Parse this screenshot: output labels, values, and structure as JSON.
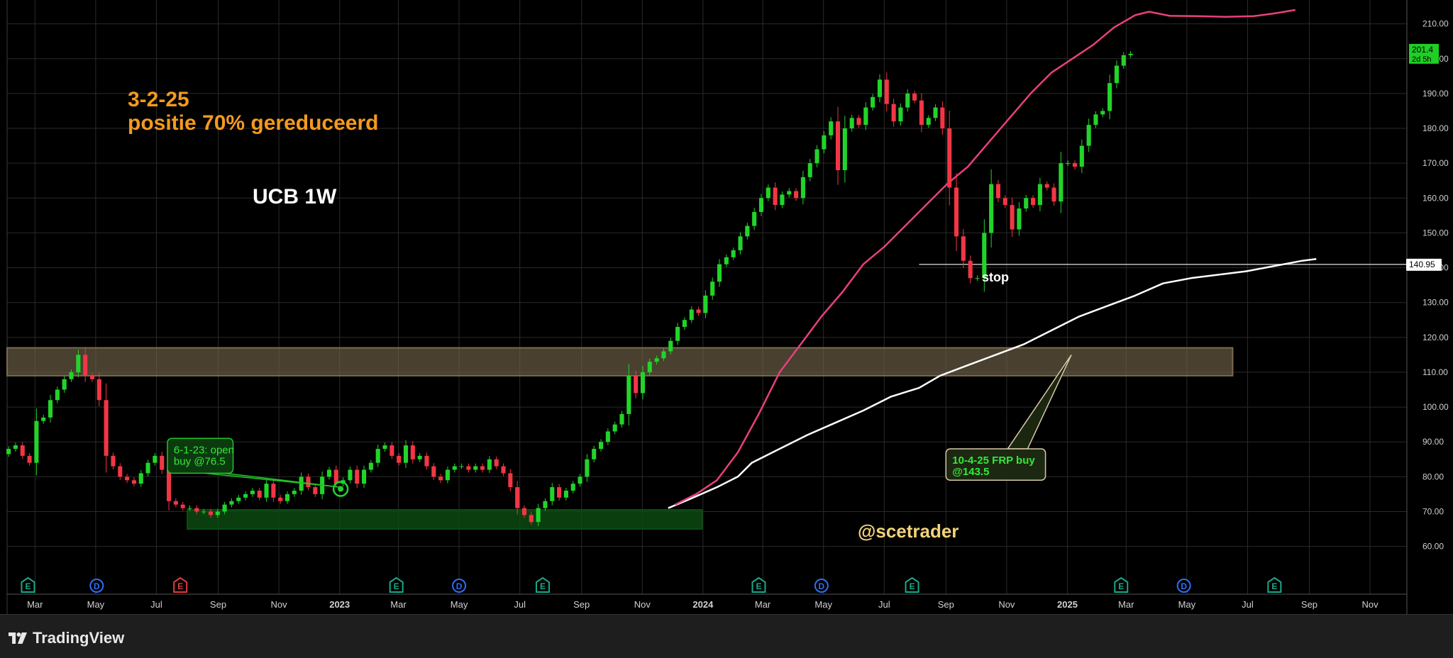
{
  "app": {
    "brand": "TradingView"
  },
  "chart_data": {
    "type": "candlestick",
    "symbol": "UCB",
    "timeframe": "1W",
    "title": "UCB 1W",
    "note_line1": "3-2-25",
    "note_line2": "positie 70% gereduceerd",
    "watermark": "@scetrader",
    "ylim": [
      53,
      214
    ],
    "y_ticks": [
      60,
      70,
      80,
      90,
      100,
      110,
      120,
      130,
      140,
      150,
      160,
      170,
      180,
      190,
      200,
      210
    ],
    "y_tick_labels": [
      "60.00",
      "70.00",
      "80.00",
      "90.00",
      "100.00",
      "110.00",
      "120.00",
      "130.00",
      "140.00",
      "150.00",
      "160.00",
      "170.00",
      "180.00",
      "190.00",
      "200.00",
      "210.00"
    ],
    "xlim": [
      "2022-02-01",
      "2025-12-08"
    ],
    "x_ticks": [
      {
        "date": "2022-03-01",
        "label": "Mar",
        "bold": false
      },
      {
        "date": "2022-05-01",
        "label": "May",
        "bold": false
      },
      {
        "date": "2022-07-01",
        "label": "Jul",
        "bold": false
      },
      {
        "date": "2022-09-01",
        "label": "Sep",
        "bold": false
      },
      {
        "date": "2022-11-01",
        "label": "Nov",
        "bold": false
      },
      {
        "date": "2023-01-01",
        "label": "2023",
        "bold": true
      },
      {
        "date": "2023-03-01",
        "label": "Mar",
        "bold": false
      },
      {
        "date": "2023-05-01",
        "label": "May",
        "bold": false
      },
      {
        "date": "2023-07-01",
        "label": "Jul",
        "bold": false
      },
      {
        "date": "2023-09-01",
        "label": "Sep",
        "bold": false
      },
      {
        "date": "2023-11-01",
        "label": "Nov",
        "bold": false
      },
      {
        "date": "2024-01-01",
        "label": "2024",
        "bold": true
      },
      {
        "date": "2024-03-01",
        "label": "Mar",
        "bold": false
      },
      {
        "date": "2024-05-01",
        "label": "May",
        "bold": false
      },
      {
        "date": "2024-07-01",
        "label": "Jul",
        "bold": false
      },
      {
        "date": "2024-09-01",
        "label": "Sep",
        "bold": false
      },
      {
        "date": "2024-11-01",
        "label": "Nov",
        "bold": false
      },
      {
        "date": "2025-01-01",
        "label": "2025",
        "bold": true
      },
      {
        "date": "2025-03-01",
        "label": "Mar",
        "bold": false
      },
      {
        "date": "2025-05-01",
        "label": "May",
        "bold": false
      },
      {
        "date": "2025-07-01",
        "label": "Jul",
        "bold": false
      },
      {
        "date": "2025-09-01",
        "label": "Sep",
        "bold": false
      },
      {
        "date": "2025-11-01",
        "label": "Nov",
        "bold": false
      }
    ],
    "price_label": {
      "value": "201.4",
      "countdown": "2d 5h",
      "price": 201.4
    },
    "stop_label": {
      "value": "140.95",
      "price": 140.95
    },
    "stop_text": "stop",
    "grid": true,
    "zones": [
      {
        "name": "resistance-zone",
        "from": "2022-02-01",
        "to": "2025-06-16",
        "low": 109,
        "high": 117,
        "fill": "#7a6a4f",
        "opacity": 0.6
      },
      {
        "name": "support-zone",
        "from": "2022-08-01",
        "to": "2023-12-31",
        "low": 65,
        "high": 70.5,
        "fill": "#0c4d12",
        "opacity": 0.8
      }
    ],
    "callouts": [
      {
        "name": "open-buy-callout",
        "line1": "6-1-23: open",
        "line2": "buy @76.5",
        "box_date": "2022-07-12",
        "box_top": 91,
        "box_bottom": 81,
        "box_width_days": 66,
        "pointer_date": "2023-01-02",
        "pointer_price": 77,
        "color": "#22c32a",
        "bg": "#0d3d10"
      },
      {
        "name": "frp-buy-callout",
        "line1": "10-4-25 FRP buy",
        "line2": "@143.5",
        "box_date": "2024-09-01",
        "box_top": 88,
        "box_bottom": 79,
        "box_width_days": 100,
        "pointer_date": "2025-01-05",
        "pointer_price": 115,
        "color": "#d8c8a8",
        "bg": "#1e2a12"
      }
    ],
    "entry_marker": {
      "date": "2023-01-02",
      "price": 76.5
    },
    "events": [
      {
        "type": "E",
        "date": "2022-02-22",
        "color": "#1aa88b"
      },
      {
        "type": "D",
        "date": "2022-05-02",
        "color": "#2f6ef5"
      },
      {
        "type": "E",
        "date": "2022-07-25",
        "color": "#e23b3b"
      },
      {
        "type": "E",
        "date": "2023-02-27",
        "color": "#1aa88b"
      },
      {
        "type": "D",
        "date": "2023-05-01",
        "color": "#2f6ef5"
      },
      {
        "type": "E",
        "date": "2023-07-24",
        "color": "#1aa88b"
      },
      {
        "type": "E",
        "date": "2024-02-26",
        "color": "#1aa88b"
      },
      {
        "type": "D",
        "date": "2024-04-29",
        "color": "#2f6ef5"
      },
      {
        "type": "E",
        "date": "2024-07-29",
        "color": "#1aa88b"
      },
      {
        "type": "E",
        "date": "2025-02-24",
        "color": "#1aa88b"
      },
      {
        "type": "D",
        "date": "2025-04-28",
        "color": "#2f6ef5"
      },
      {
        "type": "E",
        "date": "2025-07-28",
        "color": "#1aa88b"
      }
    ],
    "candle_start": "2022-01-31",
    "candle_interval_days": 7,
    "candle_closes": [
      88,
      89,
      86,
      84,
      96,
      97,
      102,
      105,
      108,
      110,
      115,
      109,
      108,
      102,
      86,
      83,
      80,
      79,
      78,
      81,
      84,
      86,
      82,
      73,
      72,
      71,
      71,
      70,
      70,
      69,
      70,
      72,
      73,
      74,
      75,
      76,
      74,
      78,
      74,
      73,
      75,
      76,
      80,
      77,
      75,
      80,
      82,
      78,
      79,
      82,
      78,
      82,
      84,
      88,
      89,
      86,
      84,
      89,
      85,
      86,
      83,
      80,
      79,
      82,
      83,
      83,
      82,
      83,
      82,
      85,
      83,
      81,
      77,
      71,
      69,
      67,
      71,
      73,
      77,
      74,
      76,
      78,
      80,
      85,
      88,
      90,
      93,
      95,
      98,
      109,
      104,
      110,
      113,
      114,
      116,
      119,
      123,
      125,
      128,
      127,
      132,
      136,
      141,
      143,
      145,
      149,
      152,
      156,
      160,
      163,
      158,
      161,
      162,
      160,
      166,
      170,
      174,
      178,
      182,
      168,
      180,
      183,
      181,
      186,
      189,
      194,
      187,
      182,
      186,
      190,
      188,
      181,
      183,
      186,
      180,
      163,
      149,
      142,
      137,
      137,
      150,
      164,
      160,
      158,
      151,
      157,
      160,
      158,
      164,
      163,
      159,
      170,
      170,
      169,
      175,
      181,
      184,
      185,
      193,
      198,
      201,
      201.4
    ],
    "ma_pink": {
      "name": "upper-band",
      "color": "#e8407f",
      "points": [
        [
          "2023-12-04",
          72
        ],
        [
          "2023-12-25",
          75
        ],
        [
          "2024-01-15",
          79
        ],
        [
          "2024-02-05",
          87
        ],
        [
          "2024-02-26",
          98
        ],
        [
          "2024-03-18",
          110
        ],
        [
          "2024-04-08",
          118
        ],
        [
          "2024-04-29",
          126
        ],
        [
          "2024-05-20",
          133
        ],
        [
          "2024-06-10",
          141
        ],
        [
          "2024-07-01",
          146
        ],
        [
          "2024-07-22",
          152
        ],
        [
          "2024-08-12",
          158
        ],
        [
          "2024-09-02",
          164
        ],
        [
          "2024-09-23",
          169
        ],
        [
          "2024-10-14",
          176
        ],
        [
          "2024-11-04",
          183
        ],
        [
          "2024-11-25",
          190
        ],
        [
          "2024-12-16",
          196
        ],
        [
          "2025-01-06",
          200
        ],
        [
          "2025-01-27",
          204
        ],
        [
          "2025-02-17",
          209
        ],
        [
          "2025-03-10",
          212.5
        ],
        [
          "2025-03-24",
          213.5
        ],
        [
          "2025-04-14",
          212.3
        ],
        [
          "2025-05-12",
          212.2
        ],
        [
          "2025-06-09",
          212
        ],
        [
          "2025-07-07",
          212.2
        ],
        [
          "2025-07-28",
          213
        ],
        [
          "2025-08-18",
          214
        ]
      ]
    },
    "ma_white": {
      "name": "ma-200w",
      "color": "#ffffff",
      "points": [
        [
          "2023-11-27",
          71
        ],
        [
          "2023-12-18",
          73.5
        ],
        [
          "2024-01-15",
          77
        ],
        [
          "2024-02-05",
          80
        ],
        [
          "2024-02-19",
          84
        ],
        [
          "2024-03-18",
          88
        ],
        [
          "2024-04-15",
          92
        ],
        [
          "2024-05-13",
          95.5
        ],
        [
          "2024-06-10",
          99
        ],
        [
          "2024-07-08",
          103
        ],
        [
          "2024-08-05",
          105.5
        ],
        [
          "2024-08-26",
          109
        ],
        [
          "2024-09-23",
          112
        ],
        [
          "2024-10-21",
          115
        ],
        [
          "2024-11-18",
          118
        ],
        [
          "2024-12-16",
          122
        ],
        [
          "2025-01-13",
          126
        ],
        [
          "2025-02-10",
          129
        ],
        [
          "2025-03-10",
          132
        ],
        [
          "2025-04-07",
          135.5
        ],
        [
          "2025-05-05",
          137
        ],
        [
          "2025-06-02",
          138
        ],
        [
          "2025-06-30",
          139
        ],
        [
          "2025-07-28",
          140.5
        ],
        [
          "2025-08-25",
          142
        ],
        [
          "2025-09-08",
          142.5
        ]
      ]
    }
  }
}
